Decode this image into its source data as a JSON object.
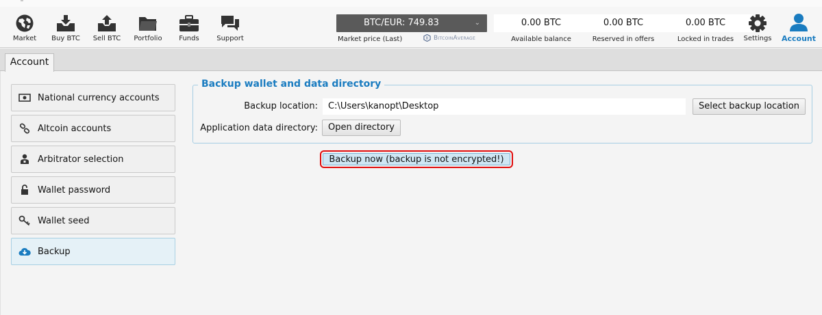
{
  "nav": {
    "market": "Market",
    "buy": "Buy BTC",
    "sell": "Sell BTC",
    "portfolio": "Portfolio",
    "funds": "Funds",
    "support": "Support",
    "settings": "Settings",
    "account": "Account"
  },
  "market_price": {
    "value": "BTC/EUR: 749.83",
    "caption": "Market price (Last)",
    "provider": "BitcoinAverage"
  },
  "balances": {
    "available": {
      "value": "0.00 BTC",
      "caption": "Available balance"
    },
    "reserved": {
      "value": "0.00 BTC",
      "caption": "Reserved in offers"
    },
    "locked": {
      "value": "0.00 BTC",
      "caption": "Locked in trades"
    }
  },
  "tab": {
    "label": "Account"
  },
  "menu": {
    "items": [
      {
        "label": "National currency accounts",
        "icon": "currency-note-icon"
      },
      {
        "label": "Altcoin accounts",
        "icon": "link-icon"
      },
      {
        "label": "Arbitrator selection",
        "icon": "arbitrator-icon"
      },
      {
        "label": "Wallet password",
        "icon": "unlock-icon"
      },
      {
        "label": "Wallet seed",
        "icon": "key-icon"
      },
      {
        "label": "Backup",
        "icon": "cloud-download-icon",
        "selected": true
      }
    ]
  },
  "backup": {
    "title": "Backup wallet and data directory",
    "location_label": "Backup location:",
    "location_value": "C:\\Users\\kanopt\\Desktop",
    "select_button": "Select backup location",
    "appdir_label": "Application data directory:",
    "open_button": "Open directory",
    "backup_now_button": "Backup now (backup is not encrypted!)"
  },
  "colors": {
    "accent": "#1a7cc0",
    "highlight_border": "#e00c0c",
    "price_box": "#5a5a5a"
  }
}
